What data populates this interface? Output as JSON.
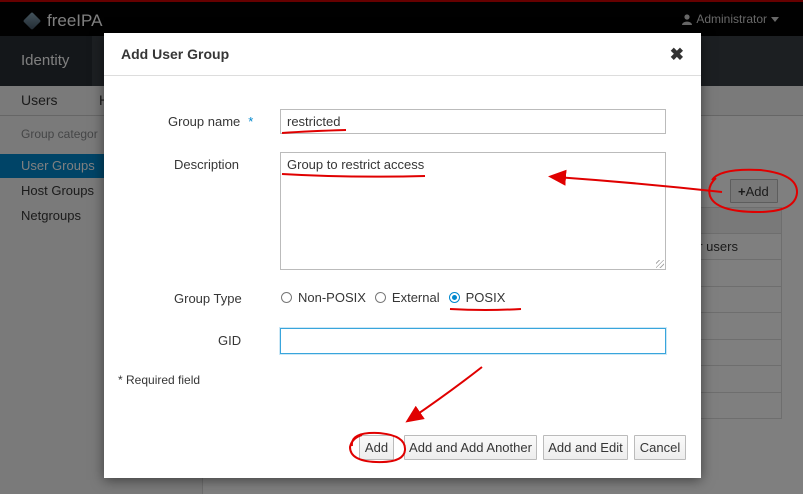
{
  "app": {
    "brand": "freeIPA",
    "user_menu": "Administrator",
    "nav_tab": "Identity",
    "subnav_users": "Users",
    "subnav_hidden": "H",
    "sidebar_heading": "Group categor",
    "sidebar_items": [
      "User Groups",
      "Host Groups",
      "Netgroups"
    ],
    "bg_add_label": "Add",
    "bg_row_text": "er users"
  },
  "dialog": {
    "title": "Add User Group",
    "close_glyph": "✖",
    "group_name_label": "Group name",
    "required_star": "*",
    "group_name_value": "restricted",
    "description_label": "Description",
    "description_value": "Group to restrict access",
    "group_type_label": "Group Type",
    "group_type_options": [
      "Non-POSIX",
      "External",
      "POSIX"
    ],
    "group_type_selected": "POSIX",
    "gid_label": "GID",
    "gid_value": "",
    "required_note": "* Required field",
    "buttons": {
      "add": "Add",
      "add_another": "Add and Add Another",
      "add_edit": "Add and Edit",
      "cancel": "Cancel"
    }
  },
  "colors": {
    "accent": "#0088ce",
    "annotation": "#e00000",
    "top_border": "#cc0000"
  },
  "icons": {
    "logo": "freeipa-logo-icon",
    "user": "user-icon",
    "caret": "caret-down-icon",
    "plus": "plus-icon",
    "close": "close-icon"
  }
}
